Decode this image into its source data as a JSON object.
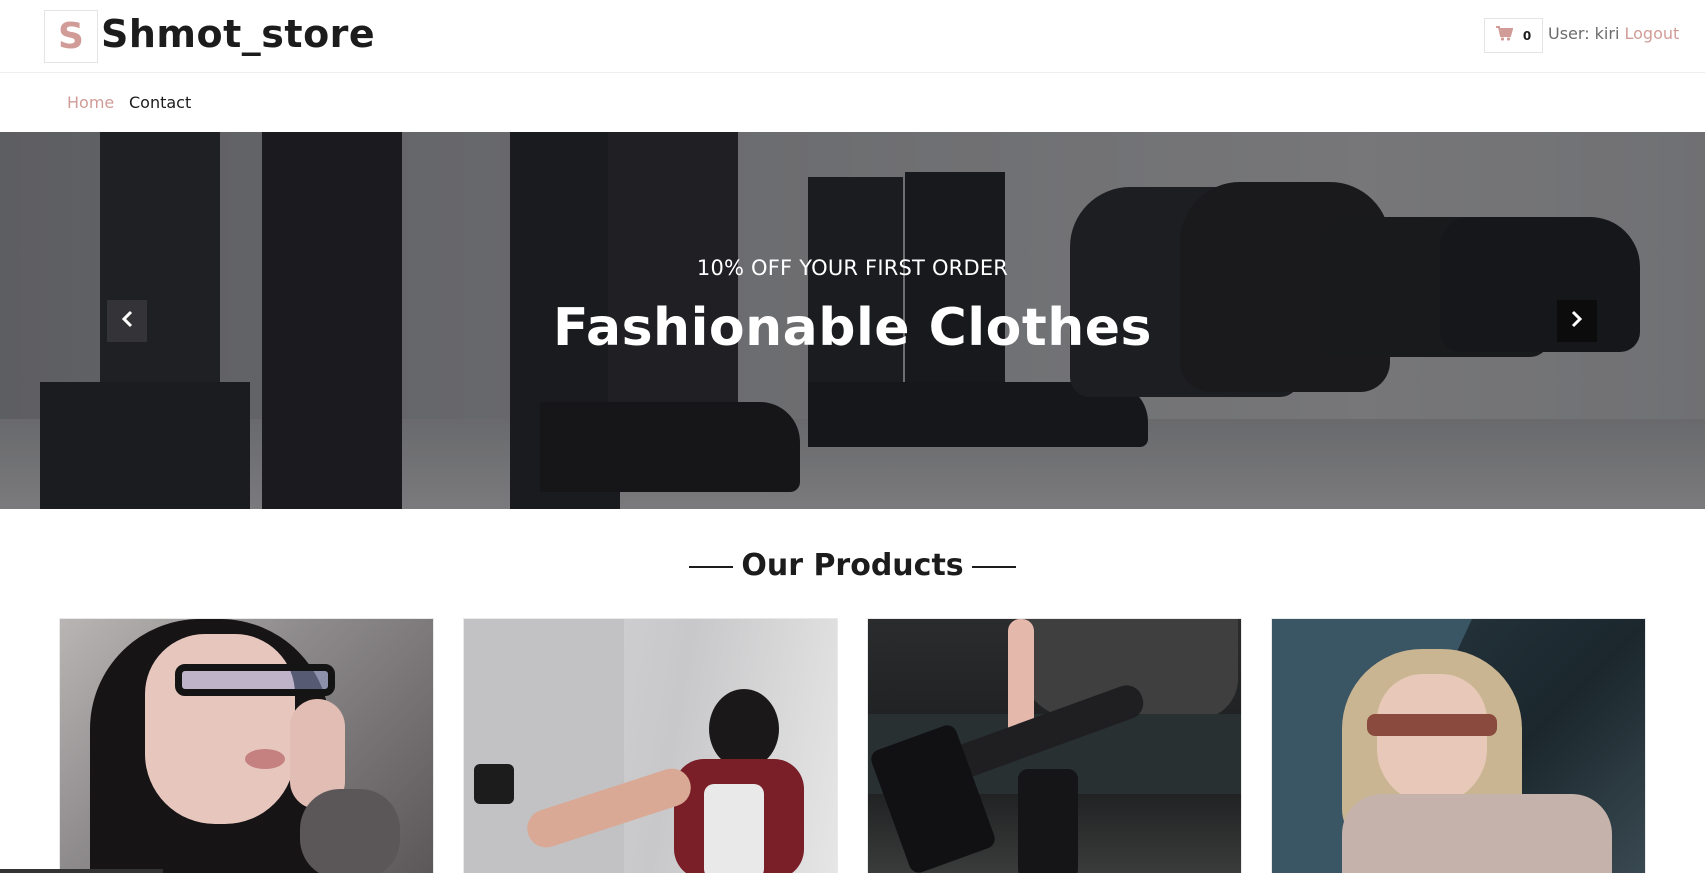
{
  "header": {
    "logo_letter": "S",
    "brand": "Shmot_store",
    "cart_count": "0",
    "user_label": "User: kiri",
    "logout_label": "Logout"
  },
  "nav": {
    "items": [
      {
        "label": "Home",
        "active": true
      },
      {
        "label": "Contact",
        "active": false
      }
    ]
  },
  "hero": {
    "subtitle": "10% OFF YOUR FIRST ORDER",
    "title": "Fashionable Clothes"
  },
  "products": {
    "title": "Our Products"
  },
  "colors": {
    "accent": "#d19c97",
    "text": "#1c1c1c"
  },
  "icons": {
    "cart": "shopping-cart-icon",
    "prev": "chevron-left-icon",
    "next": "chevron-right-icon"
  }
}
